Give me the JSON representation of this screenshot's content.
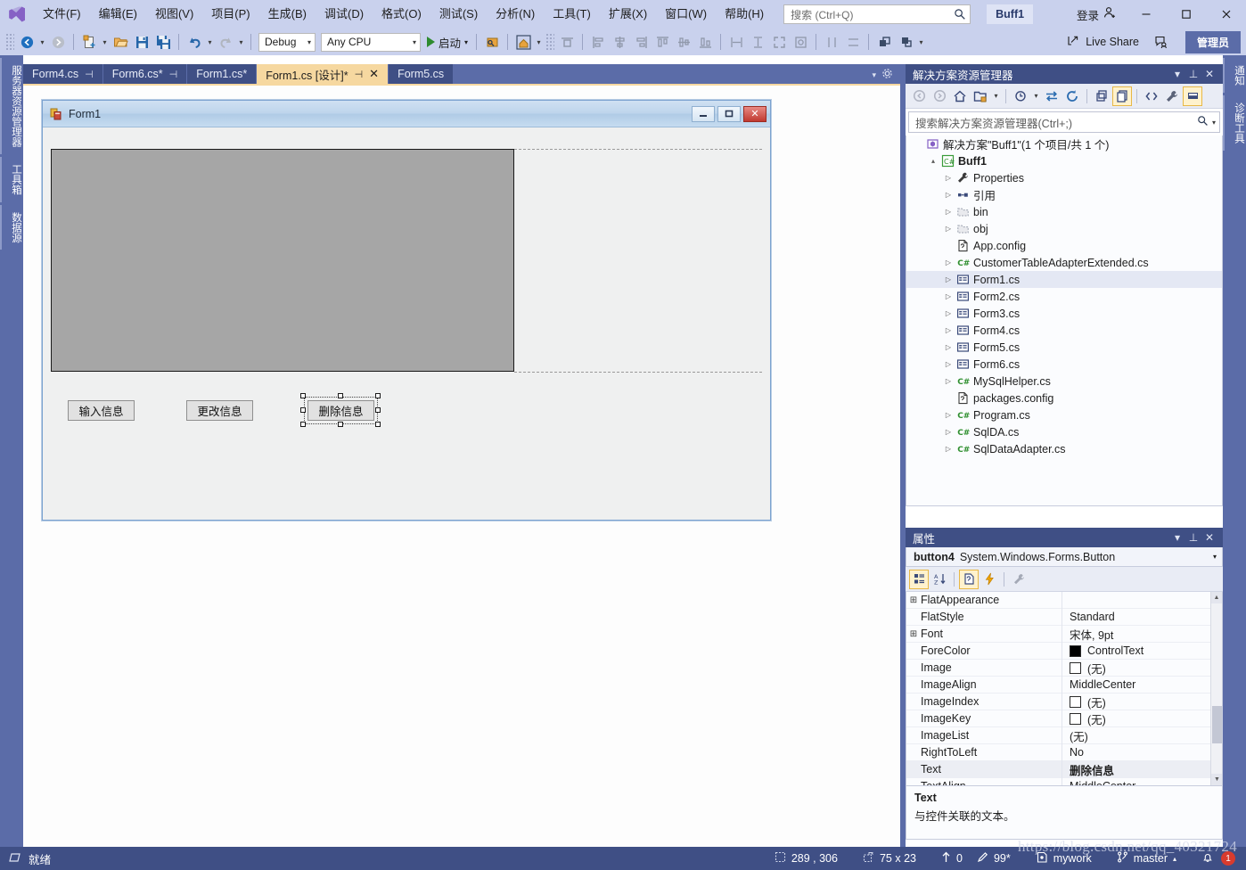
{
  "app": {
    "logo_icon": "visual-studio-logo",
    "project_chip": "Buff1",
    "signin_label": "登录",
    "signin_icon": "person-add-icon",
    "window_buttons": {
      "minimize": "—",
      "maximize": "▢",
      "close": "✕"
    }
  },
  "menu": [
    {
      "label": "文件(F)"
    },
    {
      "label": "编辑(E)"
    },
    {
      "label": "视图(V)"
    },
    {
      "label": "项目(P)"
    },
    {
      "label": "生成(B)"
    },
    {
      "label": "调试(D)"
    },
    {
      "label": "格式(O)"
    },
    {
      "label": "测试(S)"
    },
    {
      "label": "分析(N)"
    },
    {
      "label": "工具(T)"
    },
    {
      "label": "扩展(X)"
    },
    {
      "label": "窗口(W)"
    },
    {
      "label": "帮助(H)"
    }
  ],
  "search": {
    "placeholder": "搜索 (Ctrl+Q)",
    "icon": "magnifier-icon"
  },
  "toolbar": {
    "configuration": "Debug",
    "platform": "Any CPU",
    "start_label": "启动",
    "start_icon": "play-triangle-icon",
    "live_share_label": "Live Share",
    "live_share_icon": "share-icon",
    "feedback_icon": "feedback-icon",
    "admin_label": "管理员",
    "icons": [
      "navigate-backward-icon",
      "navigate-forward-icon",
      "new-item-icon",
      "open-file-icon",
      "save-icon",
      "save-all-icon",
      "undo-icon",
      "redo-icon",
      "attach-process-icon",
      "preview-form-icon",
      "align-to-grid-icon",
      "align-lefts-icon",
      "align-centers-icon",
      "align-rights-icon",
      "align-tops-icon",
      "align-middles-icon",
      "align-bottoms-icon",
      "make-same-width-icon",
      "make-same-height-icon",
      "size-to-grid-icon",
      "lock-controls-icon",
      "center-horizontally-icon",
      "center-vertically-icon",
      "bring-to-front-icon",
      "send-to-back-icon"
    ]
  },
  "left_strip": [
    {
      "label": "服务器资源管理器"
    },
    {
      "label": "工具箱"
    },
    {
      "label": "数据源"
    }
  ],
  "right_strip": [
    {
      "label": "通知"
    },
    {
      "label": "诊断工具"
    }
  ],
  "document_tabs": [
    {
      "label": "Form4.cs",
      "pin": "⊣",
      "active": false,
      "closable": false
    },
    {
      "label": "Form6.cs*",
      "pin": "⊣",
      "active": false,
      "closable": false
    },
    {
      "label": "Form1.cs*",
      "pin": "",
      "active": false,
      "closable": false
    },
    {
      "label": "Form1.cs [设计]*",
      "pin": "⊣",
      "active": true,
      "closable": true
    },
    {
      "label": "Form5.cs",
      "pin": "",
      "active": false,
      "closable": false
    }
  ],
  "designer": {
    "form": {
      "icon": "winforms-form-icon",
      "title": "Form1",
      "min_label": "—",
      "max_label": "❐",
      "close_label": "✕",
      "panel_name": "datagridview-panel",
      "buttons": [
        {
          "text": "输入信息",
          "selected": false,
          "name": "input-info-button"
        },
        {
          "text": "更改信息",
          "selected": false,
          "name": "change-info-button"
        },
        {
          "text": "删除信息",
          "selected": true,
          "name": "delete-info-button"
        }
      ]
    }
  },
  "solution_explorer": {
    "title": "解决方案资源管理器",
    "header_icons": [
      "chevron-down-icon",
      "pin-icon",
      "close-icon"
    ],
    "toolbar_icons": [
      "back-icon",
      "forward-icon",
      "home-icon",
      "new-folder-icon",
      "chevron-down-icon",
      "pending-changes-icon",
      "sync-with-active-icon",
      "refresh-icon",
      "collapse-all-icon",
      "show-all-files-icon",
      "view-code-icon",
      "properties-wrench-icon",
      "preview-pane-icon"
    ],
    "search_placeholder": "搜索解决方案资源管理器(Ctrl+;)",
    "search_icon": "magnifier-icon",
    "tree": [
      {
        "label": "解决方案\"Buff1\"(1 个项目/共 1 个)",
        "indent": 0,
        "chevron": "",
        "icon": "solution-icon",
        "bold": false,
        "selected": false
      },
      {
        "label": "Buff1",
        "indent": 1,
        "chevron": "▴",
        "icon": "csharp-project-icon",
        "bold": true,
        "selected": false
      },
      {
        "label": "Properties",
        "indent": 2,
        "chevron": "▷",
        "icon": "properties-wrench-icon",
        "bold": false,
        "selected": false
      },
      {
        "label": "引用",
        "indent": 2,
        "chevron": "▷",
        "icon": "references-icon",
        "bold": false,
        "selected": false
      },
      {
        "label": "bin",
        "indent": 2,
        "chevron": "▷",
        "icon": "folder-icon",
        "bold": false,
        "selected": false
      },
      {
        "label": "obj",
        "indent": 2,
        "chevron": "▷",
        "icon": "folder-icon",
        "bold": false,
        "selected": false
      },
      {
        "label": "App.config",
        "indent": 2,
        "chevron": "",
        "icon": "config-file-icon",
        "bold": false,
        "selected": false
      },
      {
        "label": "CustomerTableAdapterExtended.cs",
        "indent": 2,
        "chevron": "▷",
        "icon": "csharp-file-icon",
        "bold": false,
        "selected": false
      },
      {
        "label": "Form1.cs",
        "indent": 2,
        "chevron": "▷",
        "icon": "form-file-icon",
        "bold": false,
        "selected": true
      },
      {
        "label": "Form2.cs",
        "indent": 2,
        "chevron": "▷",
        "icon": "form-file-icon",
        "bold": false,
        "selected": false
      },
      {
        "label": "Form3.cs",
        "indent": 2,
        "chevron": "▷",
        "icon": "form-file-icon",
        "bold": false,
        "selected": false
      },
      {
        "label": "Form4.cs",
        "indent": 2,
        "chevron": "▷",
        "icon": "form-file-icon",
        "bold": false,
        "selected": false
      },
      {
        "label": "Form5.cs",
        "indent": 2,
        "chevron": "▷",
        "icon": "form-file-icon",
        "bold": false,
        "selected": false
      },
      {
        "label": "Form6.cs",
        "indent": 2,
        "chevron": "▷",
        "icon": "form-file-icon",
        "bold": false,
        "selected": false
      },
      {
        "label": "MySqlHelper.cs",
        "indent": 2,
        "chevron": "▷",
        "icon": "csharp-file-icon",
        "bold": false,
        "selected": false
      },
      {
        "label": "packages.config",
        "indent": 2,
        "chevron": "",
        "icon": "config-file-icon",
        "bold": false,
        "selected": false
      },
      {
        "label": "Program.cs",
        "indent": 2,
        "chevron": "▷",
        "icon": "csharp-file-icon",
        "bold": false,
        "selected": false
      },
      {
        "label": "SqlDA.cs",
        "indent": 2,
        "chevron": "▷",
        "icon": "csharp-file-icon",
        "bold": false,
        "selected": false
      },
      {
        "label": "SqlDataAdapter.cs",
        "indent": 2,
        "chevron": "▷",
        "icon": "csharp-file-icon",
        "bold": false,
        "selected": false
      }
    ]
  },
  "properties_pane": {
    "title": "属性",
    "header_icons": [
      "chevron-down-icon",
      "pin-icon",
      "close-icon"
    ],
    "object_name": "button4",
    "object_type": "System.Windows.Forms.Button",
    "toolbar_icons": [
      "categorized-icon",
      "alphabetical-icon",
      "properties-page-icon",
      "events-lightning-icon",
      "property-pages-wrench-icon"
    ],
    "rows": [
      {
        "expander": "⊞",
        "name": "FlatAppearance",
        "value": "",
        "swatch": "",
        "bold": false,
        "selected": false
      },
      {
        "expander": "",
        "name": "FlatStyle",
        "value": "Standard",
        "swatch": "",
        "bold": false,
        "selected": false
      },
      {
        "expander": "⊞",
        "name": "Font",
        "value": "宋体, 9pt",
        "swatch": "",
        "bold": false,
        "selected": false
      },
      {
        "expander": "",
        "name": "ForeColor",
        "value": "ControlText",
        "swatch": "#000000",
        "bold": false,
        "selected": false
      },
      {
        "expander": "",
        "name": "Image",
        "value": "(无)",
        "swatch": "#ffffff",
        "bold": false,
        "selected": false
      },
      {
        "expander": "",
        "name": "ImageAlign",
        "value": "MiddleCenter",
        "swatch": "",
        "bold": false,
        "selected": false
      },
      {
        "expander": "",
        "name": "ImageIndex",
        "value": "(无)",
        "swatch": "#ffffff",
        "bold": false,
        "selected": false
      },
      {
        "expander": "",
        "name": "ImageKey",
        "value": "(无)",
        "swatch": "#ffffff",
        "bold": false,
        "selected": false
      },
      {
        "expander": "",
        "name": "ImageList",
        "value": "(无)",
        "swatch": "",
        "bold": false,
        "selected": false
      },
      {
        "expander": "",
        "name": "RightToLeft",
        "value": "No",
        "swatch": "",
        "bold": false,
        "selected": false
      },
      {
        "expander": "",
        "name": "Text",
        "value": "删除信息",
        "swatch": "",
        "bold": true,
        "selected": true
      },
      {
        "expander": "",
        "name": "TextAlign",
        "value": "MiddleCenter",
        "swatch": "",
        "bold": false,
        "selected": false
      }
    ],
    "description_title": "Text",
    "description_body": "与控件关联的文本。"
  },
  "status_bar": {
    "ready_label": "就绪",
    "ready_icon": "ready-icon",
    "position": "289 , 306",
    "position_icon": "cursor-position-icon",
    "size": "75 x 23",
    "size_icon": "selection-size-icon",
    "up_count": "0",
    "up_icon": "arrow-up-icon",
    "pending_edits": "99*",
    "pending_icon": "pencil-icon",
    "repo": "mywork",
    "repo_icon": "repository-icon",
    "branch": "master",
    "branch_icon": "branch-icon",
    "bell_icon": "bell-icon",
    "bell_count": "1"
  },
  "watermark": "https://blog.csdn.net/qq_40321724",
  "colors": {
    "chrome": "#c9d1ed",
    "dock_blue": "#3f4f85",
    "strip_blue": "#5b6ca8",
    "accent_tab": "#f6d8a0",
    "status_blue": "#3f4f85"
  }
}
